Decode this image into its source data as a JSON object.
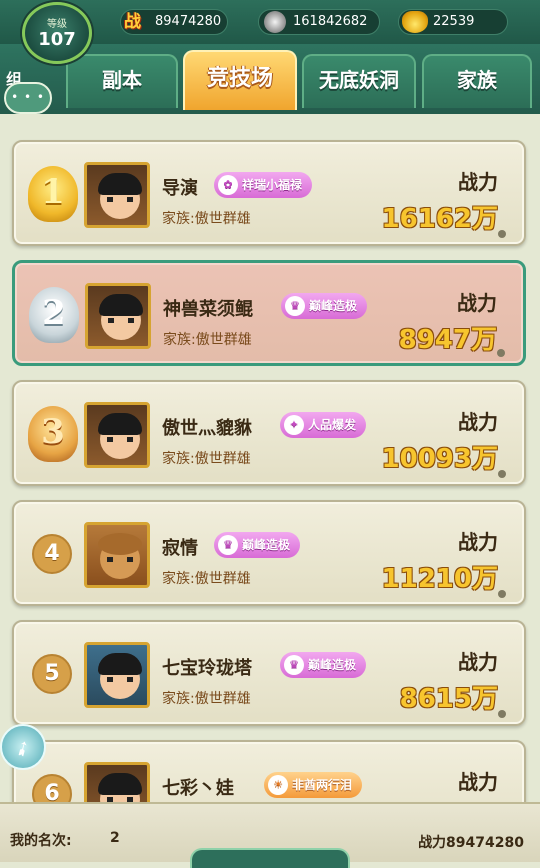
{
  "header": {
    "level_label": "等级",
    "level_value": "107",
    "power": "89474280",
    "power_icon_text": "战",
    "silver": "161842682",
    "gold": "22539"
  },
  "tabs": [
    {
      "label": "副本",
      "active": false
    },
    {
      "label": "竞技场",
      "active": true
    },
    {
      "label": "无底妖洞",
      "active": false
    },
    {
      "label": "家族",
      "active": false
    }
  ],
  "chat": {
    "label": "组"
  },
  "power_label": "战力",
  "entries": [
    {
      "rank": "1",
      "name": "导演",
      "family": "家族:傲世群雄",
      "title": "祥瑞小福禄",
      "title_style": "pink",
      "power": "16162万",
      "rank_style": "gold"
    },
    {
      "rank": "2",
      "name": "神兽菜须鲲",
      "family": "家族:傲世群雄",
      "title": "巅峰造极",
      "title_style": "pink",
      "power": "8947万",
      "rank_style": "silver",
      "is_me": true
    },
    {
      "rank": "3",
      "name": "傲世灬貔貅",
      "family": "家族:傲世群雄",
      "title": "人品爆发",
      "title_style": "pink",
      "power": "10093万",
      "rank_style": "bronze"
    },
    {
      "rank": "4",
      "name": "寂情",
      "family": "家族:傲世群雄",
      "title": "巅峰造极",
      "title_style": "pink",
      "power": "11210万",
      "rank_style": "plain"
    },
    {
      "rank": "5",
      "name": "七宝玲珑塔",
      "family": "家族:傲世群雄",
      "title": "巅峰造极",
      "title_style": "pink",
      "power": "8615万",
      "rank_style": "plain"
    },
    {
      "rank": "6",
      "name": "七彩丶娃",
      "family": "",
      "title": "非酋两行泪",
      "title_style": "orange",
      "power": "",
      "rank_style": "plain"
    }
  ],
  "footer": {
    "my_rank_label": "我的名次:",
    "my_rank_value": "2",
    "my_power": "战力89474280"
  }
}
